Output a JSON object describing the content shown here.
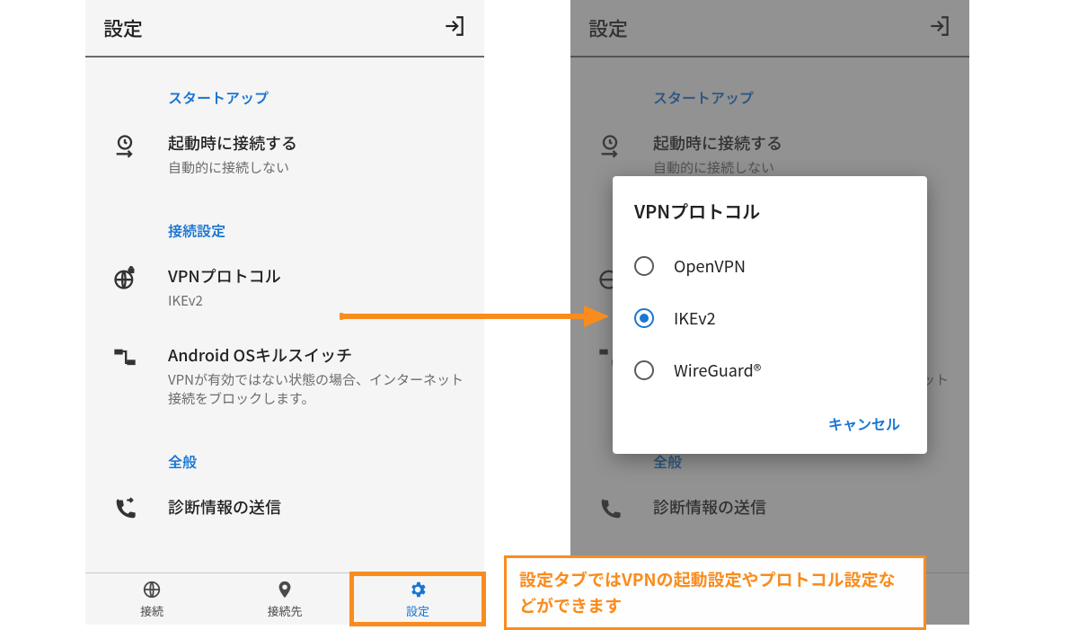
{
  "colors": {
    "accent": "#1976d2",
    "highlight": "#fa8c1d"
  },
  "topbar": {
    "title": "設定",
    "exit_icon": "exit-icon"
  },
  "sections": {
    "startup": {
      "header": "スタートアップ",
      "connect_on_boot": {
        "title": "起動時に接続する",
        "subtitle": "自動的に接続しない"
      }
    },
    "connection": {
      "header": "接続設定",
      "vpn_protocol": {
        "title": "VPNプロトコル",
        "subtitle": "IKEv2"
      },
      "kill_switch": {
        "title": "Android OSキルスイッチ",
        "subtitle": "VPNが有効ではない状態の場合、インターネット接続をブロックします。"
      }
    },
    "general": {
      "header": "全般",
      "diagnostics": {
        "title": "診断情報の送信"
      }
    }
  },
  "nav": {
    "connect": "接続",
    "locations": "接続先",
    "settings": "設定"
  },
  "dialog": {
    "title": "VPNプロトコル",
    "options": {
      "openvpn": "OpenVPN",
      "ikev2": "IKEv2",
      "wireguard": "WireGuard®"
    },
    "selected": "ikev2",
    "cancel": "キャンセル"
  },
  "caption": "設定タブではVPNの起動設定やプロトコル設定などができます"
}
